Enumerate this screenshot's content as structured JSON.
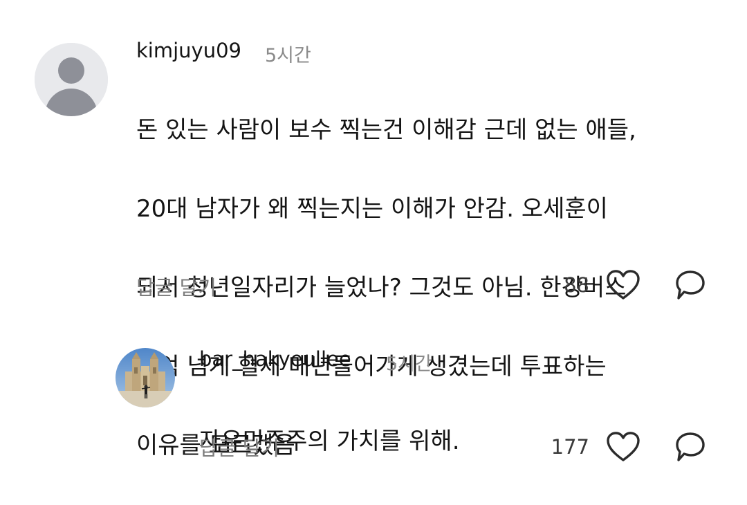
{
  "comments": [
    {
      "username": "kimjuyu09",
      "time": "5시간",
      "text_lines": [
        "돈 있는 사람이 보수 찍는건 이해감 근데 없는 애들,",
        "20대 남자가 왜 찍는지는 이해가 안감. 오세훈이",
        "되서 청년일자리가 늘었나? 그것도 아님. 한강버스",
        "백억 넘게 혈세 매년들어가게 생겼는데 투표하는",
        "이유를 모르겠음"
      ],
      "reply_label": "답글 달기",
      "like_count": "88",
      "avatar_icon": "default-avatar-icon"
    },
    {
      "username": "bar_hakyeullee",
      "time": "5시간",
      "text_lines": [
        "자유민주주의 가치를 위해."
      ],
      "reply_label": "답글 달기",
      "like_count": "177",
      "avatar_icon": "profile-photo"
    }
  ],
  "icons": {
    "like": "heart-icon",
    "reply": "speech-bubble-icon"
  },
  "colors": {
    "secondary_text": "#8a8a8a",
    "icon_stroke": "#2b2b2b",
    "avatar_bg": "#e8e9ec",
    "avatar_silhouette": "#8e9098"
  }
}
